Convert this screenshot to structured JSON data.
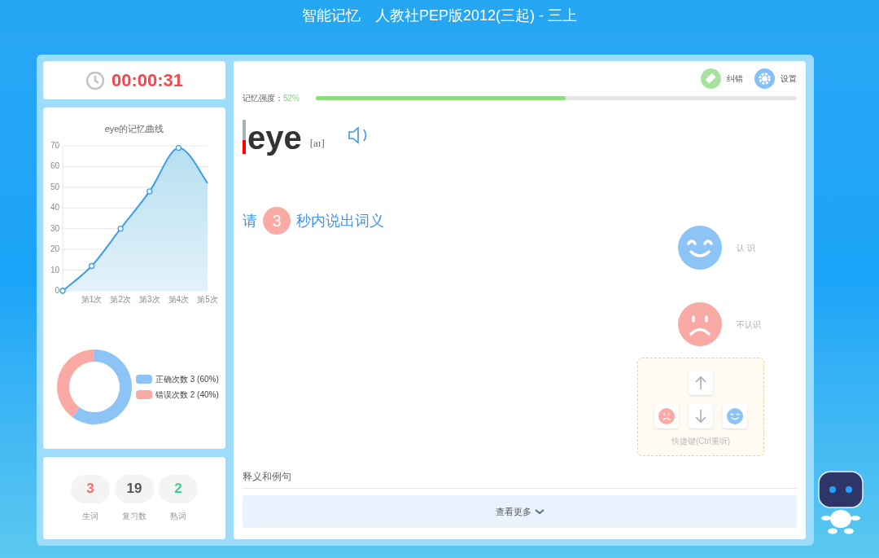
{
  "window": {
    "title": "智能记忆　人教社PEP版2012(三起) - 三上"
  },
  "timer": "00:00:31",
  "curve": {
    "title": "eye的记忆曲线",
    "chart_data": {
      "type": "area",
      "categories": [
        null,
        "第1次",
        "第2次",
        "第3次",
        "第4次",
        "第5次"
      ],
      "series": [
        {
          "color": "#3b9ef0",
          "values": [
            0,
            12,
            30,
            48,
            69,
            52
          ]
        }
      ],
      "yticks": [
        0,
        10,
        20,
        30,
        40,
        50,
        60,
        70
      ],
      "ylim": [
        0,
        70
      ],
      "grid": true
    }
  },
  "answers": {
    "chart_data": {
      "type": "donut",
      "categories": [
        "正确次数 3 (60%)",
        "错误次数 2 (40%)"
      ],
      "values": [
        3,
        2
      ],
      "colors": [
        "#8cc4f5",
        "#f9aaa4"
      ]
    }
  },
  "stats": [
    {
      "value": "3",
      "label": "生词",
      "color": "#f86c6b"
    },
    {
      "value": "19",
      "label": "复习数",
      "color": "#555555"
    },
    {
      "value": "2",
      "label": "熟词",
      "color": "#3ecf8e"
    }
  ],
  "toolbar": [
    {
      "kind": "correct",
      "label": "纠错"
    },
    {
      "kind": "settings",
      "label": "设置"
    }
  ],
  "strength": {
    "label": "记忆强度：",
    "reading": "52%",
    "level": 0.52
  },
  "word": {
    "text": "eye",
    "phonetic": "[aɪ]",
    "level": 0.4
  },
  "prompt": {
    "before": "请",
    "count": "3",
    "after": "秒内说出词义"
  },
  "choices": [
    {
      "kind": "know",
      "label": "认 识"
    },
    {
      "kind": "unknown",
      "label": "不认识"
    }
  ],
  "shortcuts": {
    "label": "快捷键(Ctrl重听)"
  },
  "section": {
    "title": "释义和例句",
    "more": "查看更多"
  }
}
